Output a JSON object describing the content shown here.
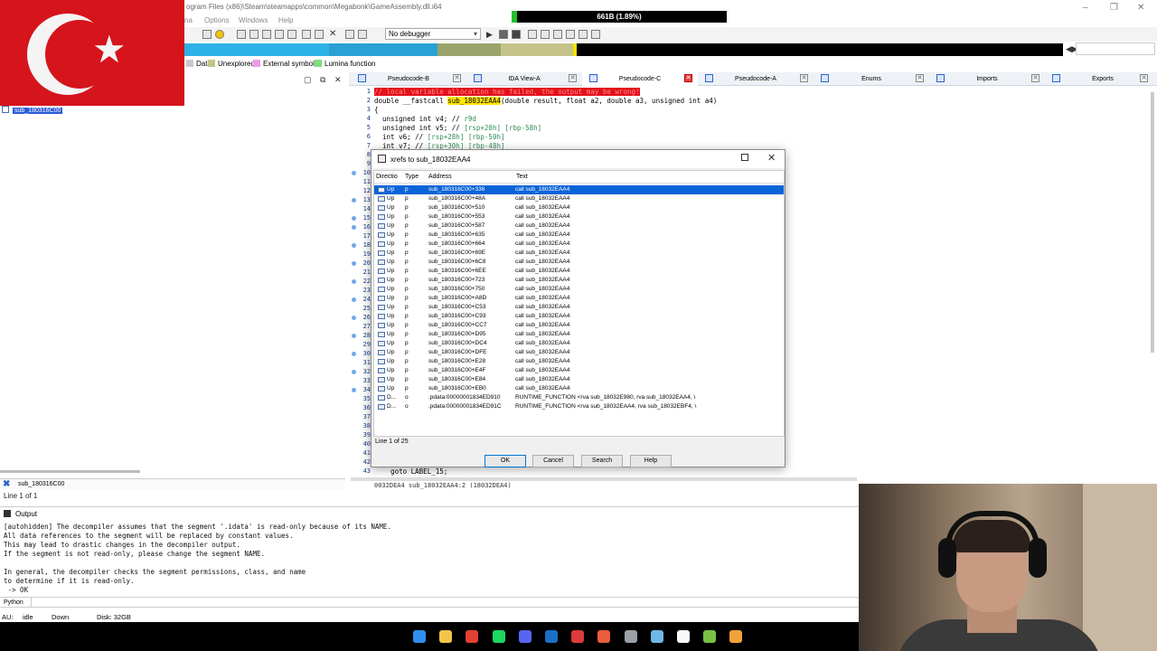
{
  "window": {
    "title": "ogram Files (x86)\\Steam\\steamapps\\common\\Megabonk\\GameAssembly.dll.i64",
    "memory_gauge": "661B (1.89%)",
    "memory_fraction": 0.0189
  },
  "menubar": {
    "items": [
      "na",
      "Options",
      "Windows",
      "Help"
    ]
  },
  "toolbar": {
    "debugger": "No debugger"
  },
  "legend": [
    {
      "label": "Data",
      "color": "#c9c9c9"
    },
    {
      "label": "Unexplored",
      "color": "#c4c48a"
    },
    {
      "label": "External symbol",
      "color": "#f09ae8"
    },
    {
      "label": "Lumina function",
      "color": "#7be07b"
    }
  ],
  "functions": {
    "selected": "sub_180316C00"
  },
  "filter": {
    "value": "sub_180316C00",
    "line_status": "Line 1 of 1"
  },
  "tabs": [
    {
      "label": "Pseudocode-B",
      "active": false
    },
    {
      "label": "IDA View-A",
      "active": false
    },
    {
      "label": "Pseudocode-C",
      "active": true
    },
    {
      "label": "Pseudocode-A",
      "active": false
    },
    {
      "label": "Enums",
      "active": false
    },
    {
      "label": "Imports",
      "active": false
    },
    {
      "label": "Exports",
      "active": false
    }
  ],
  "code": {
    "error_line": "// local variable allocation has failed, the output may be wrong!",
    "signature_pre": "double __fastcall ",
    "signature_fn": "sub_18032EAA4",
    "signature_post": "(double result, float a2, double a3, unsigned int a4)",
    "open_brace": "{",
    "decls": [
      {
        "code": "  unsigned int v4; // ",
        "comment": "r9d"
      },
      {
        "code": "  unsigned int v5; // ",
        "comment": "[rsp+20h] [rbp-58h]"
      },
      {
        "code": "  int v6; // ",
        "comment": "[rsp+28h] [rbp-50h]"
      },
      {
        "code": "  int v7; // ",
        "comment": "[rsp+30h] [rbp-48h]"
      }
    ],
    "goto_line": "    goto LABEL_15;",
    "line_numbers": [
      "1",
      "2",
      "3",
      "4",
      "5",
      "6",
      "7",
      "8",
      "9",
      "10",
      "11",
      "12",
      "13",
      "14",
      "15",
      "16",
      "17",
      "18",
      "19",
      "20",
      "21",
      "22",
      "23",
      "24",
      "25",
      "26",
      "27",
      "28",
      "29",
      "30",
      "31",
      "32",
      "33",
      "34",
      "35",
      "36",
      "37",
      "38",
      "39",
      "40",
      "41",
      "42",
      "43"
    ],
    "status_address": "0032DEA4 sub_18032EAA4:2 (18032DEA4)"
  },
  "xrefs_dialog": {
    "title": "xrefs to sub_18032EAA4",
    "columns": {
      "direction": "Directio",
      "type": "Type",
      "address": "Address",
      "text": "Text"
    },
    "rows": [
      {
        "dir": "Up",
        "type": "p",
        "address": "sub_180316C00+336",
        "text": "call    sub_18032EAA4"
      },
      {
        "dir": "Up",
        "type": "p",
        "address": "sub_180316C00+48A",
        "text": "call    sub_18032EAA4"
      },
      {
        "dir": "Up",
        "type": "p",
        "address": "sub_180316C00+510",
        "text": "call    sub_18032EAA4"
      },
      {
        "dir": "Up",
        "type": "p",
        "address": "sub_180316C00+553",
        "text": "call    sub_18032EAA4"
      },
      {
        "dir": "Up",
        "type": "p",
        "address": "sub_180316C00+587",
        "text": "call    sub_18032EAA4"
      },
      {
        "dir": "Up",
        "type": "p",
        "address": "sub_180316C00+635",
        "text": "call    sub_18032EAA4"
      },
      {
        "dir": "Up",
        "type": "p",
        "address": "sub_180316C00+664",
        "text": "call    sub_18032EAA4"
      },
      {
        "dir": "Up",
        "type": "p",
        "address": "sub_180316C00+69E",
        "text": "call    sub_18032EAA4"
      },
      {
        "dir": "Up",
        "type": "p",
        "address": "sub_180316C00+6C8",
        "text": "call    sub_18032EAA4"
      },
      {
        "dir": "Up",
        "type": "p",
        "address": "sub_180316C00+6EE",
        "text": "call    sub_18032EAA4"
      },
      {
        "dir": "Up",
        "type": "p",
        "address": "sub_180316C00+723",
        "text": "call    sub_18032EAA4"
      },
      {
        "dir": "Up",
        "type": "p",
        "address": "sub_180316C00+750",
        "text": "call    sub_18032EAA4"
      },
      {
        "dir": "Up",
        "type": "p",
        "address": "sub_180316C00+A8D",
        "text": "call    sub_18032EAA4"
      },
      {
        "dir": "Up",
        "type": "p",
        "address": "sub_180316C00+C53",
        "text": "call    sub_18032EAA4"
      },
      {
        "dir": "Up",
        "type": "p",
        "address": "sub_180316C00+C93",
        "text": "call    sub_18032EAA4"
      },
      {
        "dir": "Up",
        "type": "p",
        "address": "sub_180316C00+CC7",
        "text": "call    sub_18032EAA4"
      },
      {
        "dir": "Up",
        "type": "p",
        "address": "sub_180316C00+D95",
        "text": "call    sub_18032EAA4"
      },
      {
        "dir": "Up",
        "type": "p",
        "address": "sub_180316C00+DC4",
        "text": "call    sub_18032EAA4"
      },
      {
        "dir": "Up",
        "type": "p",
        "address": "sub_180316C00+DFE",
        "text": "call    sub_18032EAA4"
      },
      {
        "dir": "Up",
        "type": "p",
        "address": "sub_180316C00+E28",
        "text": "call    sub_18032EAA4"
      },
      {
        "dir": "Up",
        "type": "p",
        "address": "sub_180316C00+E4F",
        "text": "call    sub_18032EAA4"
      },
      {
        "dir": "Up",
        "type": "p",
        "address": "sub_180316C00+E84",
        "text": "call    sub_18032EAA4"
      },
      {
        "dir": "Up",
        "type": "p",
        "address": "sub_180316C00+EB0",
        "text": "call    sub_18032EAA4"
      },
      {
        "dir": "D...",
        "type": "o",
        "address": ".pdata:00000001834ED910",
        "text": "RUNTIME_FUNCTION <rva sub_18032E980, rva sub_18032EAA4, \\"
      },
      {
        "dir": "D...",
        "type": "o",
        "address": ".pdata:00000001834ED91C",
        "text": "RUNTIME_FUNCTION <rva sub_18032EAA4, rva sub_18032EBF4, \\"
      }
    ],
    "line_count": "Line 1 of 25",
    "buttons": {
      "ok": "OK",
      "cancel": "Cancel",
      "search": "Search",
      "help": "Help"
    }
  },
  "output": {
    "title": "Output",
    "text": "[autohidden] The decompiler assumes that the segment '.idata' is read-only because of its NAME.\nAll data references to the segment will be replaced by constant values.\nThis may lead to drastic changes in the decompiler output.\nIf the segment is not read-only, please change the segment NAME.\n\nIn general, the decompiler checks the segment permissions, class, and name\nto determine if it is read-only.\n -> OK",
    "lang": "Python"
  },
  "statusbar": {
    "au": "AU:",
    "state": "idle",
    "direction": "Down",
    "disk": "Disk: 32GB"
  },
  "taskbar": {
    "icons": [
      "windows-start-icon",
      "file-explorer-icon",
      "chrome-icon",
      "spotify-icon",
      "discord-icon",
      "steam-icon",
      "media-icon",
      "app-icon",
      "settings-icon",
      "ida-icon",
      "capcut-icon",
      "notepad-icon",
      "megabonk-icon"
    ]
  }
}
